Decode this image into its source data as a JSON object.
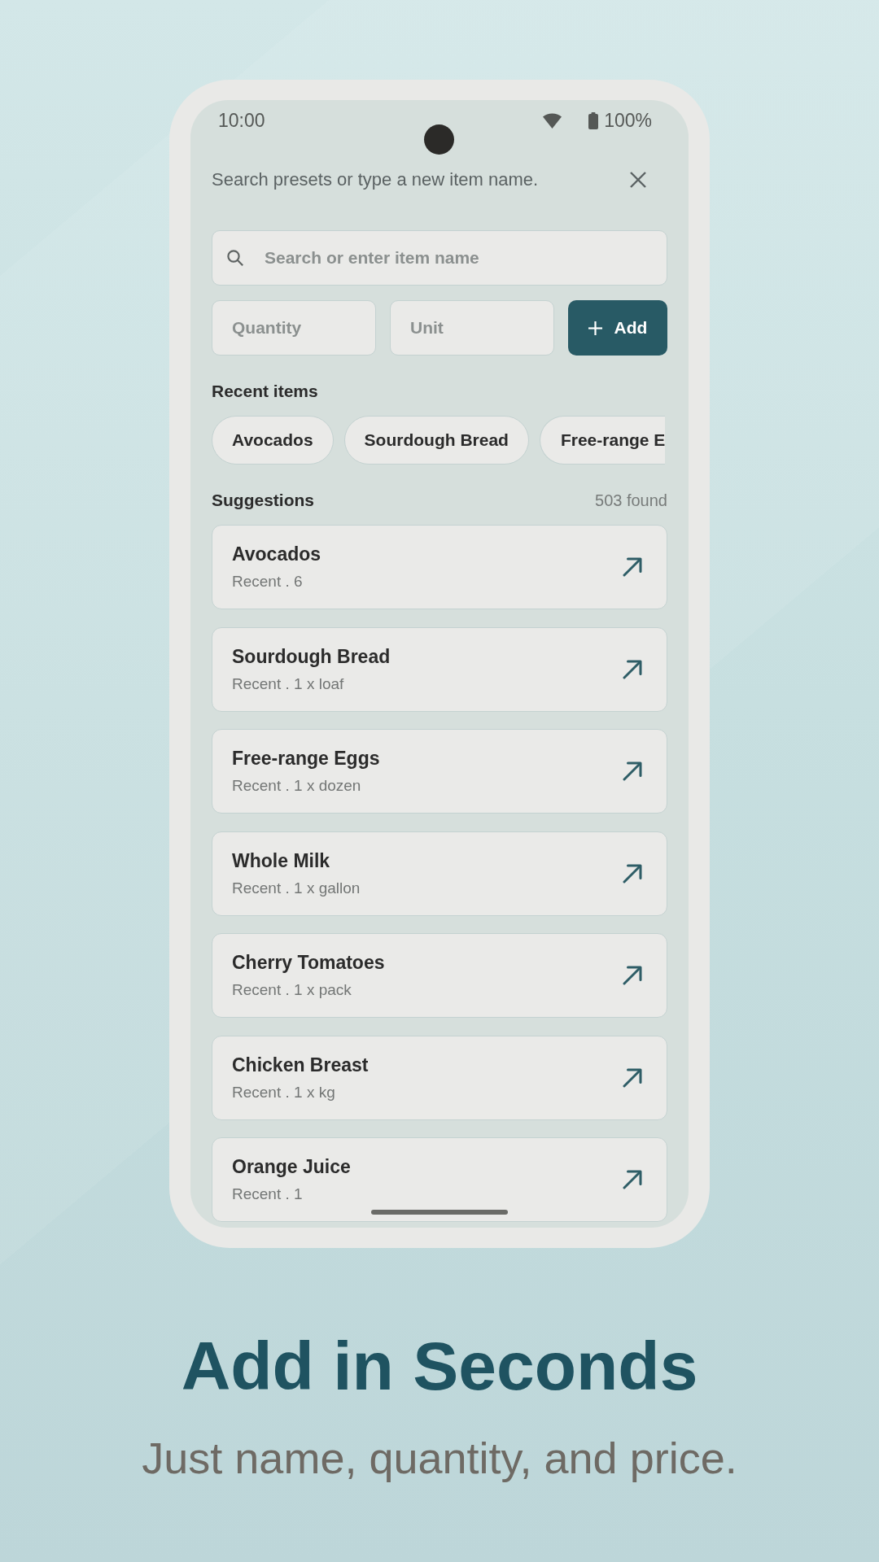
{
  "status_bar": {
    "time": "10:00",
    "battery": "100%"
  },
  "header": {
    "hint": "Search presets or type a new item name."
  },
  "search": {
    "placeholder": "Search or enter item name"
  },
  "quantity": {
    "placeholder": "Quantity"
  },
  "unit": {
    "placeholder": "Unit"
  },
  "add_button": {
    "label": "Add"
  },
  "recent": {
    "title": "Recent items",
    "chips": [
      "Avocados",
      "Sourdough Bread",
      "Free-range E"
    ]
  },
  "suggestions": {
    "title": "Suggestions",
    "count": "503 found",
    "items": [
      {
        "name": "Avocados",
        "detail": "Recent . 6"
      },
      {
        "name": "Sourdough Bread",
        "detail": "Recent . 1 x loaf"
      },
      {
        "name": "Free-range Eggs",
        "detail": "Recent . 1 x dozen"
      },
      {
        "name": "Whole Milk",
        "detail": "Recent . 1 x gallon"
      },
      {
        "name": "Cherry Tomatoes",
        "detail": "Recent . 1 x pack"
      },
      {
        "name": "Chicken Breast",
        "detail": "Recent . 1 x kg"
      },
      {
        "name": "Orange Juice",
        "detail": "Recent . 1"
      }
    ]
  },
  "promo": {
    "headline": "Add in Seconds",
    "subline": "Just name, quantity, and price."
  }
}
